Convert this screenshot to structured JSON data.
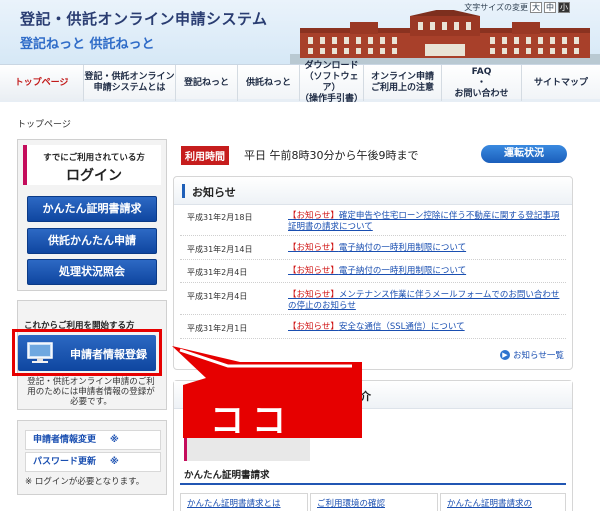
{
  "header": {
    "title": "登記・供託オンライン申請システム",
    "subtitle": "登記ねっと 供託ねっと",
    "font_size_label": "文字サイズの変更",
    "font_sizes": [
      "大",
      "中",
      "小"
    ]
  },
  "nav": {
    "items": [
      {
        "label": "トップページ"
      },
      {
        "label": "登記・供託オンライン\n申請システムとは"
      },
      {
        "label": "登記ねっと"
      },
      {
        "label": "供託ねっと"
      },
      {
        "label": "ダウンロード\n（ソフトウェア）\n（操作手引書）"
      },
      {
        "label": "オンライン申請\nご利用上の注意"
      },
      {
        "label": "FAQ\n・\nお問い合わせ"
      },
      {
        "label": "サイトマップ"
      }
    ]
  },
  "breadcrumb": "トップページ",
  "login": {
    "caption": "すでにご利用されている方",
    "title": "ログイン",
    "buttons": [
      "かんたん証明書請求",
      "供託かんたん申請",
      "処理状況照会"
    ]
  },
  "start": {
    "title": "これからご利用を開始する方",
    "register_label": "申請者情報登録",
    "note": "登記・供託オンライン申請のご利用のためには申請者情報の登録が必要です。"
  },
  "account": {
    "links": [
      {
        "label": "申請者情報変更",
        "mark": "※"
      },
      {
        "label": "パスワード更新",
        "mark": "※"
      }
    ],
    "note": "※ ログインが必要となります。"
  },
  "hours": {
    "tag": "利用時間",
    "text": "平日 午前8時30分から午後9時まで",
    "status_button": "運転状況"
  },
  "news": {
    "title": "お知らせ",
    "items": [
      {
        "date": "平成31年2月18日",
        "tag": "【お知らせ】",
        "text": "確定申告や住宅ローン控除に伴う不動産に関する登記事項証明書の請求について"
      },
      {
        "date": "平成31年2月14日",
        "tag": "【お知らせ】",
        "text": "電子納付の一時利用制限について"
      },
      {
        "date": "平成31年2月4日",
        "tag": "【お知らせ】",
        "text": "電子納付の一時利用制限について"
      },
      {
        "date": "平成31年2月4日",
        "tag": "【お知らせ】",
        "text": "メンテナンス作業に伴うメールフォームでのお問い合わせの停止のお知らせ"
      },
      {
        "date": "平成31年2月1日",
        "tag": "【お知らせ】",
        "text": "安全な通信（SSL通信）について"
      }
    ],
    "more": "お知らせ一覧"
  },
  "intro": {
    "title_partial": "紹介",
    "cert_heading": "かんたん証明書請求",
    "cols": [
      "かんたん証明書請求とは",
      "ご利用環境の確認",
      "かんたん証明書請求の"
    ]
  },
  "callout": {
    "text": "ココ",
    "color": "#e60000"
  }
}
